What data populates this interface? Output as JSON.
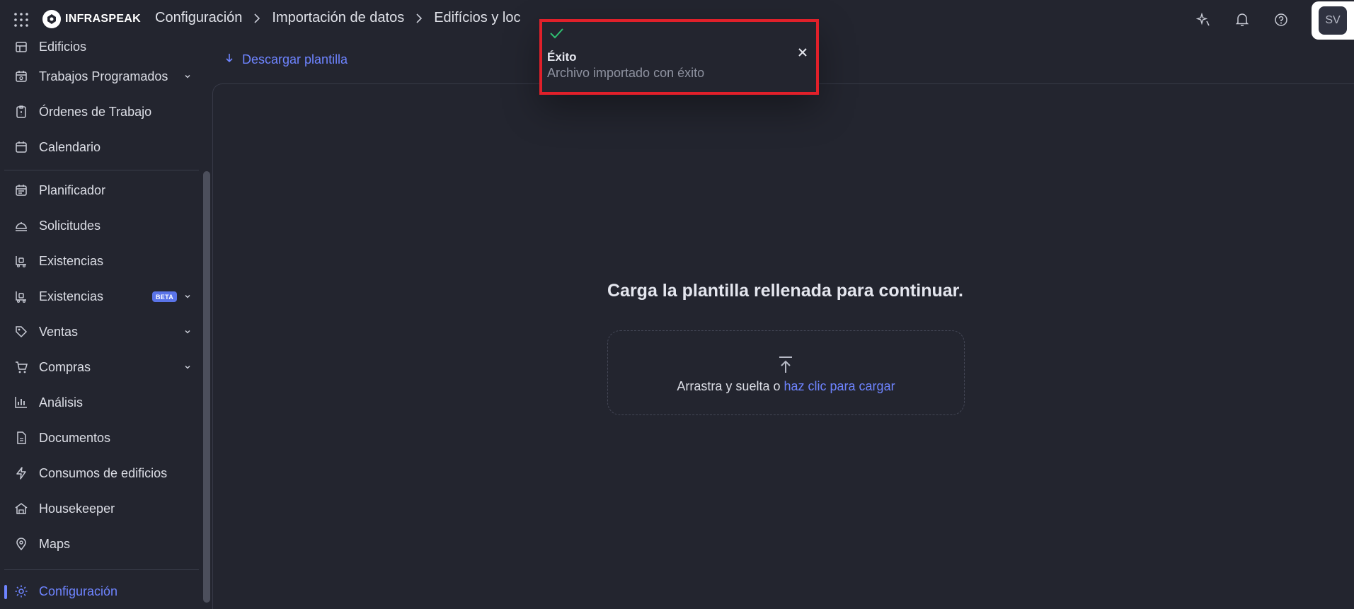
{
  "brand": {
    "name": "INFRASPEAK"
  },
  "breadcrumb": [
    "Configuración",
    "Importación de datos",
    "Edifícios y loc"
  ],
  "user": {
    "initials": "SV"
  },
  "sidebar": {
    "items": [
      {
        "label": "Edificios",
        "icon": "building-icon"
      },
      {
        "label": "Trabajos Programados",
        "icon": "calendar-clock-icon",
        "expandable": true
      },
      {
        "label": "Órdenes de Trabajo",
        "icon": "clipboard-icon"
      },
      {
        "label": "Calendario",
        "icon": "calendar-icon"
      },
      {
        "label": "Planificador",
        "icon": "planner-icon"
      },
      {
        "label": "Solicitudes",
        "icon": "bell-service-icon"
      },
      {
        "label": "Existencias",
        "icon": "stock-icon"
      },
      {
        "label": "Existencias",
        "icon": "stock-icon",
        "badge": "BETA",
        "expandable": true
      },
      {
        "label": "Ventas",
        "icon": "tag-icon",
        "expandable": true
      },
      {
        "label": "Compras",
        "icon": "cart-icon",
        "expandable": true
      },
      {
        "label": "Análisis",
        "icon": "bar-chart-icon"
      },
      {
        "label": "Documentos",
        "icon": "document-icon"
      },
      {
        "label": "Consumos de edificios",
        "icon": "bolt-icon"
      },
      {
        "label": "Housekeeper",
        "icon": "housekeeper-icon"
      },
      {
        "label": "Maps",
        "icon": "map-pin-icon"
      },
      {
        "label": "Configuración",
        "icon": "gear-icon",
        "active": true
      }
    ]
  },
  "main": {
    "download_label": "Descargar plantilla",
    "upload_title": "Carga la plantilla rellenada para continuar.",
    "drop_text": "Arrastra y suelta o",
    "drop_link": "haz clic para cargar"
  },
  "toast": {
    "title": "Éxito",
    "message": "Archivo importado con éxito"
  },
  "colors": {
    "background": "#23252f",
    "accent": "#6e84ff",
    "success": "#2fbf71",
    "highlight_border": "#e0202a"
  }
}
